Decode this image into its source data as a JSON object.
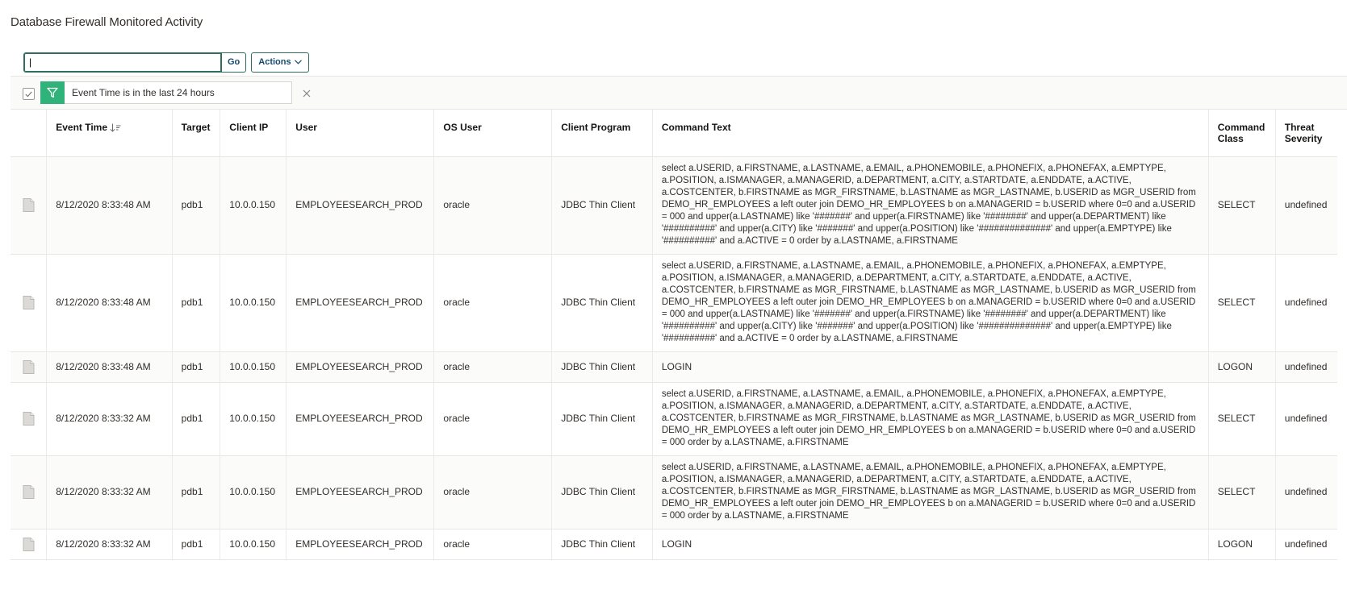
{
  "page": {
    "title": "Database Firewall Monitored Activity"
  },
  "toolbar": {
    "search_value": "|",
    "go_label": "Go",
    "actions_label": "Actions"
  },
  "filter": {
    "text": "Event Time is in the last 24 hours"
  },
  "table": {
    "columns": [
      "Event Time",
      "Target",
      "Client IP",
      "User",
      "OS User",
      "Client Program",
      "Command Text",
      "Command Class",
      "Threat Severity"
    ],
    "column_command_class": [
      "Command",
      "Class"
    ],
    "column_threat_severity": [
      "Threat",
      "Severity"
    ],
    "rows": [
      {
        "event_time": "8/12/2020 8:33:48 AM",
        "target": "pdb1",
        "client_ip": "10.0.0.150",
        "user": "EMPLOYEESEARCH_PROD",
        "os_user": "oracle",
        "client_program": "JDBC Thin Client",
        "command_text": "select a.USERID, a.FIRSTNAME, a.LASTNAME, a.EMAIL, a.PHONEMOBILE, a.PHONEFIX, a.PHONEFAX, a.EMPTYPE, a.POSITION, a.ISMANAGER, a.MANAGERID, a.DEPARTMENT, a.CITY, a.STARTDATE, a.ENDDATE, a.ACTIVE, a.COSTCENTER, b.FIRSTNAME as MGR_FIRSTNAME, b.LASTNAME as MGR_LASTNAME, b.USERID as MGR_USERID from DEMO_HR_EMPLOYEES a left outer join DEMO_HR_EMPLOYEES b on a.MANAGERID = b.USERID where 0=0 and a.USERID = 000 and upper(a.LASTNAME) like '#######' and upper(a.FIRSTNAME) like '########' and upper(a.DEPARTMENT) like '##########' and upper(a.CITY) like '#######' and upper(a.POSITION) like '##############' and upper(a.EMPTYPE) like '##########' and a.ACTIVE = 0 order by a.LASTNAME, a.FIRSTNAME",
        "command_class": "SELECT",
        "threat_severity": "undefined"
      },
      {
        "event_time": "8/12/2020 8:33:48 AM",
        "target": "pdb1",
        "client_ip": "10.0.0.150",
        "user": "EMPLOYEESEARCH_PROD",
        "os_user": "oracle",
        "client_program": "JDBC Thin Client",
        "command_text": "select a.USERID, a.FIRSTNAME, a.LASTNAME, a.EMAIL, a.PHONEMOBILE, a.PHONEFIX, a.PHONEFAX, a.EMPTYPE, a.POSITION, a.ISMANAGER, a.MANAGERID, a.DEPARTMENT, a.CITY, a.STARTDATE, a.ENDDATE, a.ACTIVE, a.COSTCENTER, b.FIRSTNAME as MGR_FIRSTNAME, b.LASTNAME as MGR_LASTNAME, b.USERID as MGR_USERID from DEMO_HR_EMPLOYEES a left outer join DEMO_HR_EMPLOYEES b on a.MANAGERID = b.USERID where 0=0 and a.USERID = 000 and upper(a.LASTNAME) like '#######' and upper(a.FIRSTNAME) like '########' and upper(a.DEPARTMENT) like '##########' and upper(a.CITY) like '#######' and upper(a.POSITION) like '##############' and upper(a.EMPTYPE) like '##########' and a.ACTIVE = 0 order by a.LASTNAME, a.FIRSTNAME",
        "command_class": "SELECT",
        "threat_severity": "undefined"
      },
      {
        "event_time": "8/12/2020 8:33:48 AM",
        "target": "pdb1",
        "client_ip": "10.0.0.150",
        "user": "EMPLOYEESEARCH_PROD",
        "os_user": "oracle",
        "client_program": "JDBC Thin Client",
        "command_text": "LOGIN",
        "command_class": "LOGON",
        "threat_severity": "undefined"
      },
      {
        "event_time": "8/12/2020 8:33:32 AM",
        "target": "pdb1",
        "client_ip": "10.0.0.150",
        "user": "EMPLOYEESEARCH_PROD",
        "os_user": "oracle",
        "client_program": "JDBC Thin Client",
        "command_text": "select a.USERID, a.FIRSTNAME, a.LASTNAME, a.EMAIL, a.PHONEMOBILE, a.PHONEFIX, a.PHONEFAX, a.EMPTYPE, a.POSITION, a.ISMANAGER, a.MANAGERID, a.DEPARTMENT, a.CITY, a.STARTDATE, a.ENDDATE, a.ACTIVE, a.COSTCENTER, b.FIRSTNAME as MGR_FIRSTNAME, b.LASTNAME as MGR_LASTNAME, b.USERID as MGR_USERID from DEMO_HR_EMPLOYEES a left outer join DEMO_HR_EMPLOYEES b on a.MANAGERID = b.USERID where 0=0 and a.USERID = 000 order by a.LASTNAME, a.FIRSTNAME",
        "command_class": "SELECT",
        "threat_severity": "undefined"
      },
      {
        "event_time": "8/12/2020 8:33:32 AM",
        "target": "pdb1",
        "client_ip": "10.0.0.150",
        "user": "EMPLOYEESEARCH_PROD",
        "os_user": "oracle",
        "client_program": "JDBC Thin Client",
        "command_text": "select a.USERID, a.FIRSTNAME, a.LASTNAME, a.EMAIL, a.PHONEMOBILE, a.PHONEFIX, a.PHONEFAX, a.EMPTYPE, a.POSITION, a.ISMANAGER, a.MANAGERID, a.DEPARTMENT, a.CITY, a.STARTDATE, a.ENDDATE, a.ACTIVE, a.COSTCENTER, b.FIRSTNAME as MGR_FIRSTNAME, b.LASTNAME as MGR_LASTNAME, b.USERID as MGR_USERID from DEMO_HR_EMPLOYEES a left outer join DEMO_HR_EMPLOYEES b on a.MANAGERID = b.USERID where 0=0 and a.USERID = 000 order by a.LASTNAME, a.FIRSTNAME",
        "command_class": "SELECT",
        "threat_severity": "undefined"
      },
      {
        "event_time": "8/12/2020 8:33:32 AM",
        "target": "pdb1",
        "client_ip": "10.0.0.150",
        "user": "EMPLOYEESEARCH_PROD",
        "os_user": "oracle",
        "client_program": "JDBC Thin Client",
        "command_text": "LOGIN",
        "command_class": "LOGON",
        "threat_severity": "undefined"
      }
    ]
  },
  "icons": {
    "row_detail": "document-icon",
    "sort": "sort-descending-icon",
    "filter": "funnel-icon",
    "remove": "close-icon",
    "checkbox": "check-icon",
    "dropdown": "chevron-down-icon"
  },
  "colors": {
    "accent_green": "#2fb37a",
    "button_border": "#2f6e5f",
    "button_text": "#174a6e"
  }
}
